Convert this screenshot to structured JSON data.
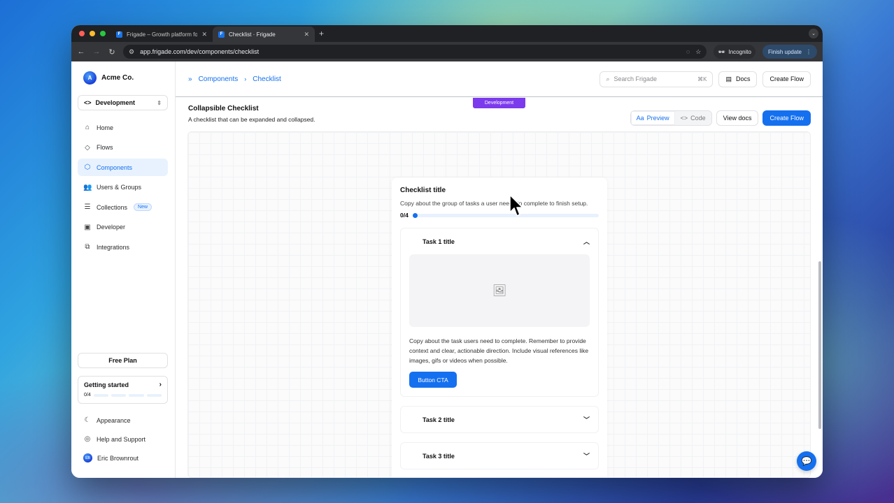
{
  "browser": {
    "tabs": [
      {
        "title": "Frigade – Growth platform fo",
        "active": false
      },
      {
        "title": "Checklist · Frigade",
        "active": true
      }
    ],
    "url": "app.frigade.com/dev/components/checklist",
    "incognito_label": "Incognito",
    "finish_update_label": "Finish update"
  },
  "sidebar": {
    "org_initial": "A",
    "org_name": "Acme Co.",
    "environment": "Development",
    "nav": [
      {
        "label": "Home",
        "icon": "home-icon",
        "active": false
      },
      {
        "label": "Flows",
        "icon": "layers-icon",
        "active": false
      },
      {
        "label": "Components",
        "icon": "cube-icon",
        "active": true
      },
      {
        "label": "Users & Groups",
        "icon": "users-icon",
        "active": false
      },
      {
        "label": "Collections",
        "icon": "list-icon",
        "active": false,
        "badge": "New"
      },
      {
        "label": "Developer",
        "icon": "terminal-icon",
        "active": false
      },
      {
        "label": "Integrations",
        "icon": "puzzle-icon",
        "active": false
      }
    ],
    "free_plan": "Free Plan",
    "getting_started": {
      "title": "Getting started",
      "progress": "0/4"
    },
    "bottom": {
      "appearance": "Appearance",
      "help": "Help and Support",
      "user_initials": "EB",
      "user_name": "Eric Brownrout"
    }
  },
  "topbar": {
    "breadcrumb": [
      "Components",
      "Checklist"
    ],
    "search_placeholder": "Search Frigade",
    "search_shortcut": "⌘K",
    "docs_label": "Docs",
    "create_flow_label": "Create Flow"
  },
  "env_pill": "Development",
  "section": {
    "title": "Collapsible Checklist",
    "subtitle": "A checklist that can be expanded and collapsed.",
    "preview_label": "Preview",
    "code_label": "Code",
    "view_docs_label": "View docs",
    "create_flow_label": "Create Flow"
  },
  "checklist": {
    "title": "Checklist title",
    "description": "Copy about the group of tasks a user needs to complete to finish setup.",
    "progress_text": "0/4",
    "tasks": [
      {
        "title": "Task 1 title",
        "expanded": true,
        "body": "Copy about the task users need to complete. Remember to provide context and clear, actionable direction. Include visual references like images, gifs or videos when possible.",
        "cta": "Button CTA"
      },
      {
        "title": "Task 2 title",
        "expanded": false
      },
      {
        "title": "Task 3 title",
        "expanded": false
      }
    ]
  },
  "colors": {
    "accent": "#1570ef",
    "dev_pill": "#7c3aed"
  }
}
